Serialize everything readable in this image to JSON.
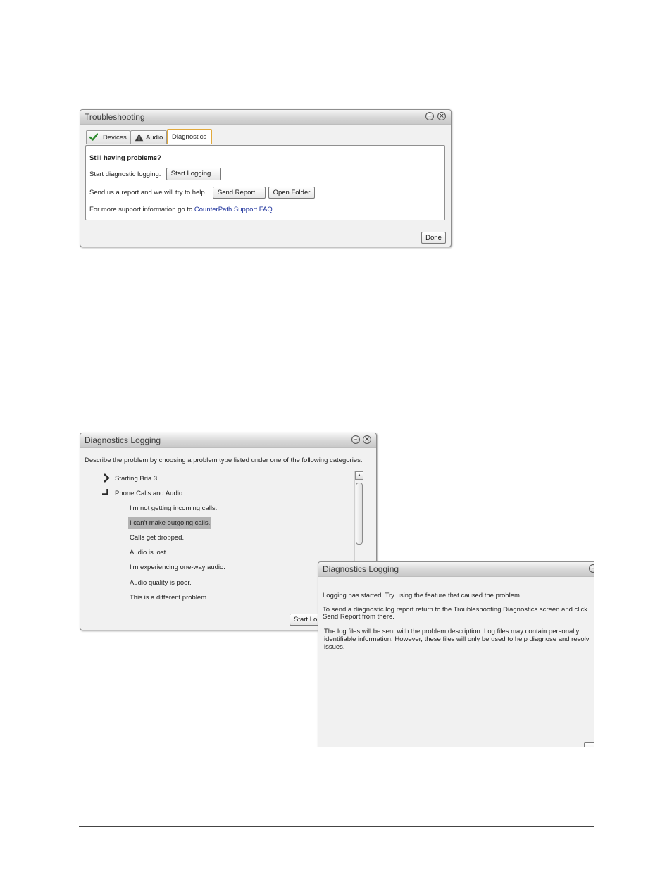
{
  "troubleshooting": {
    "title": "Troubleshooting",
    "tabs": [
      {
        "label": "Devices",
        "icon": "checkmark-icon"
      },
      {
        "label": "Audio",
        "icon": "warning-icon"
      },
      {
        "label": "Diagnostics",
        "active": true
      }
    ],
    "heading": "Still having problems?",
    "logging_text": "Start diagnostic logging.",
    "start_logging_label": "Start Logging...",
    "report_text": "Send us a report and we will try to help.",
    "send_report_label": "Send Report...",
    "open_folder_label": "Open Folder",
    "support_text": "For more support information go to",
    "support_link": "CounterPath Support FAQ",
    "support_suffix": ".",
    "done_label": "Done"
  },
  "diagnostics": {
    "title": "Diagnostics Logging",
    "instructions": "Describe the problem by choosing a problem type listed under one of the following categories.",
    "categories": [
      {
        "label": "Starting Bria 3",
        "expanded": false
      },
      {
        "label": "Phone Calls and Audio",
        "expanded": true
      }
    ],
    "problems": [
      "I'm not getting incoming calls.",
      "I can't make outgoing calls.",
      "Calls get dropped.",
      "Audio is lost.",
      "I'm experiencing one-way audio.",
      "Audio quality is poor.",
      "This is a different problem."
    ],
    "selected_index": 1,
    "start_button_label": "Start Lo"
  },
  "logging_started": {
    "title": "Diagnostics Logging",
    "line1": "Logging has started. Try using the feature that caused the problem.",
    "line2a": "To send a diagnostic log report return to the Troubleshooting Diagnostics screen and click",
    "line2b": "Send Report from there.",
    "line3a": "The log files will be sent with the problem description. Log files may contain personally",
    "line3b": "identifiable information. However, these files will only be used to help diagnose and resolv",
    "line3c": "issues."
  },
  "colors": {
    "tab_active_border": "#e1a93c",
    "link": "#1a2f9a",
    "checkmark": "#2b8a2b",
    "selection": "#b3b3b3"
  }
}
